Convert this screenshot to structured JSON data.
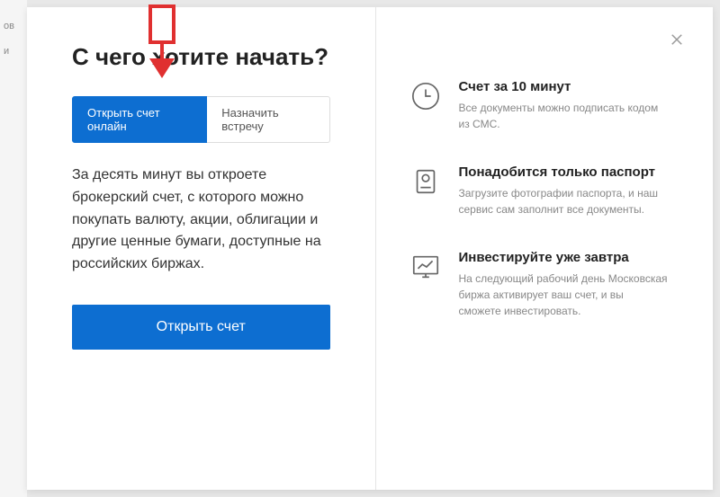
{
  "modal": {
    "title": "С чего хотите начать?",
    "tabs": {
      "online": "Открыть счет онлайн",
      "meeting": "Назначить встречу"
    },
    "description": "За десять минут вы откроете брокерский счет, с которого можно покупать валюту, акции, облигации и другие ценные бумаги, доступные на российских биржах.",
    "primaryButton": "Открыть счет"
  },
  "features": {
    "f1": {
      "title": "Счет за 10 минут",
      "desc": "Все документы можно подписать кодом из СМС."
    },
    "f2": {
      "title": "Понадобится только паспорт",
      "desc": "Загрузите фотографии паспорта, и наш сервис сам заполнит все документы."
    },
    "f3": {
      "title": "Инвестируйте уже завтра",
      "desc": "На следующий рабочий день Московская биржа активирует ваш счет, и вы сможете инвестировать."
    }
  },
  "backdrop": {
    "t1": "ов",
    "t2": "и"
  }
}
